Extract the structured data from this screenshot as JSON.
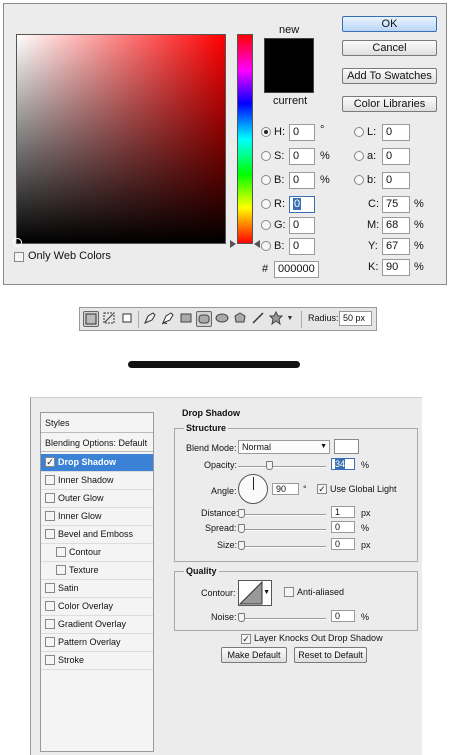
{
  "color_picker": {
    "new_label": "new",
    "current_label": "current",
    "buttons": {
      "ok": "OK",
      "cancel": "Cancel",
      "add_to_swatches": "Add To Swatches",
      "color_libraries": "Color Libraries"
    },
    "only_web_colors": "Only Web Colors",
    "hsb": [
      {
        "label": "H:",
        "value": "0",
        "unit": "°",
        "selected": true
      },
      {
        "label": "S:",
        "value": "0",
        "unit": "%",
        "selected": false
      },
      {
        "label": "B:",
        "value": "0",
        "unit": "%",
        "selected": false
      }
    ],
    "rgb": [
      {
        "label": "R:",
        "value": "0"
      },
      {
        "label": "G:",
        "value": "0"
      },
      {
        "label": "B:",
        "value": "0"
      }
    ],
    "lab": [
      {
        "label": "L:",
        "value": "0"
      },
      {
        "label": "a:",
        "value": "0"
      },
      {
        "label": "b:",
        "value": "0"
      }
    ],
    "cmyk": [
      {
        "label": "C:",
        "value": "75",
        "unit": "%"
      },
      {
        "label": "M:",
        "value": "68",
        "unit": "%"
      },
      {
        "label": "Y:",
        "value": "67",
        "unit": "%"
      },
      {
        "label": "K:",
        "value": "90",
        "unit": "%"
      }
    ],
    "hex_label": "#",
    "hex_value": "000000",
    "colors": {
      "new": "#000000",
      "current": "#000000",
      "hue_base": "#ff0000"
    }
  },
  "toolbar": {
    "icons": [
      "shape-layers-icon",
      "paths-icon",
      "fill-pixels-icon",
      "pen-tool-icon",
      "freeform-pen-icon",
      "rectangle-tool-icon",
      "rounded-rectangle-tool-icon",
      "ellipse-tool-icon",
      "polygon-tool-icon",
      "line-tool-icon",
      "custom-shape-tool-icon",
      "dropdown-arrow-icon"
    ],
    "radius_label": "Radius:",
    "radius_value": "50 px"
  },
  "layer_style": {
    "styles_header": "Styles",
    "blending_options": "Blending Options: Default",
    "items": [
      {
        "label": "Drop Shadow",
        "checked": true,
        "selected": true,
        "indent": false
      },
      {
        "label": "Inner Shadow",
        "checked": false,
        "indent": false
      },
      {
        "label": "Outer Glow",
        "checked": false,
        "indent": false
      },
      {
        "label": "Inner Glow",
        "checked": false,
        "indent": false
      },
      {
        "label": "Bevel and Emboss",
        "checked": false,
        "indent": false
      },
      {
        "label": "Contour",
        "checked": false,
        "indent": true
      },
      {
        "label": "Texture",
        "checked": false,
        "indent": true
      },
      {
        "label": "Satin",
        "checked": false,
        "indent": false
      },
      {
        "label": "Color Overlay",
        "checked": false,
        "indent": false
      },
      {
        "label": "Gradient Overlay",
        "checked": false,
        "indent": false
      },
      {
        "label": "Pattern Overlay",
        "checked": false,
        "indent": false
      },
      {
        "label": "Stroke",
        "checked": false,
        "indent": false
      }
    ],
    "panel_title": "Drop Shadow",
    "structure_title": "Structure",
    "blend_mode_label": "Blend Mode:",
    "blend_mode_value": "Normal",
    "shadow_color": "#ffffff",
    "opacity_label": "Opacity:",
    "opacity_value": "34",
    "opacity_unit": "%",
    "angle_label": "Angle:",
    "angle_value": "90",
    "angle_unit": "°",
    "use_global_light": "Use Global Light",
    "distance_label": "Distance:",
    "distance_value": "1",
    "distance_unit": "px",
    "spread_label": "Spread:",
    "spread_value": "0",
    "spread_unit": "%",
    "size_label": "Size:",
    "size_value": "0",
    "size_unit": "px",
    "quality_title": "Quality",
    "contour_label": "Contour:",
    "anti_aliased": "Anti-aliased",
    "noise_label": "Noise:",
    "noise_value": "0",
    "noise_unit": "%",
    "layer_knocks_out": "Layer Knocks Out Drop Shadow",
    "make_default": "Make Default",
    "reset_to_default": "Reset to Default"
  }
}
